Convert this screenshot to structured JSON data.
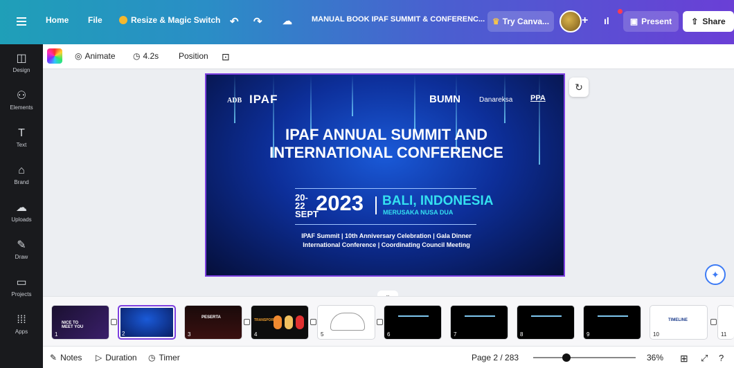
{
  "topbar": {
    "home": "Home",
    "file": "File",
    "resize": "Resize & Magic Switch",
    "doc_title": "MANUAL BOOK IPAF SUMMIT & CONFERENC...",
    "try_canva": "Try Canva...",
    "present": "Present",
    "share": "Share"
  },
  "sidebar": {
    "items": [
      {
        "label": "Design",
        "icon": "design-icon",
        "glyph": "◫"
      },
      {
        "label": "Elements",
        "icon": "elements-icon",
        "glyph": "⚇"
      },
      {
        "label": "Text",
        "icon": "text-icon",
        "glyph": "T"
      },
      {
        "label": "Brand",
        "icon": "brand-icon",
        "glyph": "⌂"
      },
      {
        "label": "Uploads",
        "icon": "uploads-icon",
        "glyph": "☁"
      },
      {
        "label": "Draw",
        "icon": "draw-icon",
        "glyph": "✎"
      },
      {
        "label": "Projects",
        "icon": "projects-icon",
        "glyph": "▭"
      },
      {
        "label": "Apps",
        "icon": "apps-icon",
        "glyph": "⁞⁞⁞"
      }
    ]
  },
  "toolbar": {
    "animate": "Animate",
    "duration": "4.2s",
    "position": "Position"
  },
  "slide": {
    "adb": "ADB",
    "ipaf": "IPAF",
    "bumn": "BUMN",
    "danareksa": "Danareksa",
    "ppa": "PPA",
    "title": "IPAF ANNUAL SUMMIT AND INTERNATIONAL CONFERENCE",
    "dates_line1": "20-22",
    "dates_line2": "SEPT",
    "year": "2023",
    "location": "BALI, INDONESIA",
    "venue": "MERUSAKA NUSA DUA",
    "events_line1": "IPAF Summit | 10th Anniversary Celebration | Gala Dinner",
    "events_line2": "International Conference | Coordinating Council Meeting"
  },
  "filmstrip": {
    "pages": [
      "1",
      "2",
      "3",
      "4",
      "5",
      "6",
      "7",
      "8",
      "9",
      "10",
      "11"
    ],
    "thumb10_label": "TIMELINE",
    "thumb1_text": "NICE TO MEET YOU",
    "thumb3_text": "PESERTA",
    "thumb4_text": "TRANSPORTASI"
  },
  "status": {
    "notes": "Notes",
    "duration": "Duration",
    "timer": "Timer",
    "page": "Page 2 / 283",
    "zoom": "36%",
    "zoom_fraction": 0.36
  },
  "colors": {
    "accent": "#7d3fe0",
    "topbar_start": "#1f9fb8",
    "topbar_end": "#6a3fd6",
    "slide_blue": "#0d2f9a",
    "highlight_cyan": "#34e0f0"
  }
}
